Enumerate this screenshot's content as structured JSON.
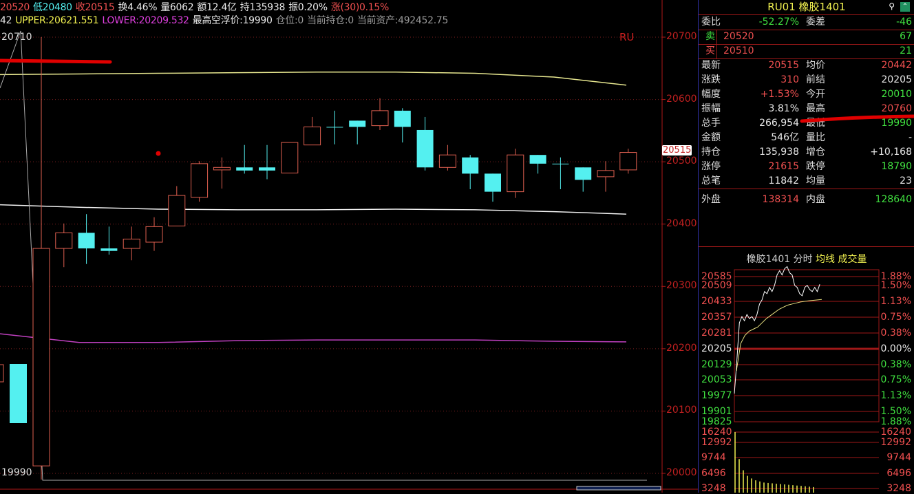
{
  "header": {
    "line1": [
      {
        "text": "20520",
        "color": "red"
      },
      {
        "text": "低20480",
        "color": "cyan"
      },
      {
        "text": "收20515",
        "color": "red"
      },
      {
        "text": "换4.46%",
        "color": "wht"
      },
      {
        "text": "量6062",
        "color": "wht"
      },
      {
        "text": "额12.4亿",
        "color": "wht"
      },
      {
        "text": "持135938",
        "color": "wht"
      },
      {
        "text": "振0.20%",
        "color": "wht"
      },
      {
        "text": "涨(30)0.15%",
        "color": "red"
      }
    ],
    "line2": [
      {
        "text": "42",
        "color": "wht"
      },
      {
        "text": "UPPER:20621.551",
        "color": "yel"
      },
      {
        "text": "LOWER:20209.532",
        "color": "mag"
      },
      {
        "text": "最高空浮价:19990",
        "color": "wht"
      },
      {
        "text": "仓位:0",
        "color": "gry"
      },
      {
        "text": "当前持仓:0",
        "color": "gry"
      },
      {
        "text": "当前资产:492452.75",
        "color": "gry"
      }
    ]
  },
  "chart": {
    "symbol_tag": "RU",
    "high_mark": "20710",
    "low_mark": "19990",
    "last_price_tag": "20515",
    "y_ticks": [
      "20700",
      "20600",
      "20500",
      "20400",
      "20300",
      "20200",
      "20100",
      "20000"
    ],
    "colors": {
      "up": "#e06050",
      "down": "#54f0f0",
      "upper": "#e8e890",
      "mid": "#f0f0f0",
      "lower": "#c040c0"
    }
  },
  "chart_data": {
    "type": "candlestick",
    "ylim": [
      19990,
      20720
    ],
    "candles": [
      {
        "o": 20012,
        "c": 20361,
        "h": 20700,
        "l": 19990
      },
      {
        "o": 20361,
        "c": 20386,
        "h": 20401,
        "l": 20331
      },
      {
        "o": 20386,
        "c": 20361,
        "h": 20416,
        "l": 20336
      },
      {
        "o": 20361,
        "c": 20357,
        "h": 20396,
        "l": 20351
      },
      {
        "o": 20361,
        "c": 20376,
        "h": 20396,
        "l": 20342
      },
      {
        "o": 20371,
        "c": 20396,
        "h": 20411,
        "l": 20357
      },
      {
        "o": 20397,
        "c": 20446,
        "h": 20461,
        "l": 20397
      },
      {
        "o": 20443,
        "c": 20497,
        "h": 20501,
        "l": 20436
      },
      {
        "o": 20487,
        "c": 20491,
        "h": 20507,
        "l": 20457
      },
      {
        "o": 20491,
        "c": 20486,
        "h": 20527,
        "l": 20481
      },
      {
        "o": 20491,
        "c": 20486,
        "h": 20527,
        "l": 20472
      },
      {
        "o": 20482,
        "c": 20531,
        "h": 20531,
        "l": 20482
      },
      {
        "o": 20527,
        "c": 20556,
        "h": 20572,
        "l": 20527
      },
      {
        "o": 20556,
        "c": 20556,
        "h": 20582,
        "l": 20528
      },
      {
        "o": 20566,
        "c": 20556,
        "h": 20566,
        "l": 20528
      },
      {
        "o": 20558,
        "c": 20582,
        "h": 20602,
        "l": 20551
      },
      {
        "o": 20582,
        "c": 20556,
        "h": 20586,
        "l": 20531
      },
      {
        "o": 20551,
        "c": 20491,
        "h": 20572,
        "l": 20486
      },
      {
        "o": 20491,
        "c": 20511,
        "h": 20527,
        "l": 20486
      },
      {
        "o": 20507,
        "c": 20481,
        "h": 20511,
        "l": 20456
      },
      {
        "o": 20481,
        "c": 20452,
        "h": 20481,
        "l": 20436
      },
      {
        "o": 20452,
        "c": 20511,
        "h": 20521,
        "l": 20442
      },
      {
        "o": 20511,
        "c": 20497,
        "h": 20511,
        "l": 20481
      },
      {
        "o": 20497,
        "c": 20497,
        "h": 20507,
        "l": 20456
      },
      {
        "o": 20491,
        "c": 20471,
        "h": 20491,
        "l": 20452
      },
      {
        "o": 20476,
        "c": 20486,
        "h": 20501,
        "l": 20452
      },
      {
        "o": 20487,
        "c": 20515,
        "h": 20521,
        "l": 20481
      }
    ],
    "bollinger": {
      "upper": [
        20640,
        20641,
        20642,
        20643,
        20644,
        20644,
        20642,
        20636,
        20623
      ],
      "mid": [
        20431,
        20427,
        20424,
        20423,
        20423,
        20424,
        20423,
        20420,
        20416
      ],
      "lower": [
        20224,
        20210,
        20210,
        20213,
        20214,
        20214,
        20214,
        20212,
        20211
      ]
    }
  },
  "quote": {
    "title": "RU01  橡胶1401",
    "rows": [
      {
        "l1": "委比",
        "v1": "-52.27%",
        "c1": "grn",
        "l2": "委差",
        "v2": "-46",
        "c2": "grn"
      },
      {
        "l1": "卖",
        "v1": "20520",
        "c1": "red",
        "l2": "",
        "v2": "67",
        "c2": "grn"
      },
      {
        "l1": "买",
        "v1": "20510",
        "c1": "red",
        "l2": "",
        "v2": "21",
        "c2": "grn"
      },
      {
        "l1": "最新",
        "v1": "20515",
        "c1": "red",
        "l2": "均价",
        "v2": "20442",
        "c2": "red"
      },
      {
        "l1": "涨跌",
        "v1": "310",
        "c1": "red",
        "l2": "前结",
        "v2": "20205",
        "c2": "wht"
      },
      {
        "l1": "幅度",
        "v1": "+1.53%",
        "c1": "red",
        "l2": "今开",
        "v2": "20010",
        "c2": "grn"
      },
      {
        "l1": "振幅",
        "v1": "3.81%",
        "c1": "wht",
        "l2": "最高",
        "v2": "20760",
        "c2": "red"
      },
      {
        "l1": "总手",
        "v1": "266,954",
        "c1": "wht",
        "l2": "最低",
        "v2": "19990",
        "c2": "grn"
      },
      {
        "l1": "金额",
        "v1": "546亿",
        "c1": "wht",
        "l2": "量比",
        "v2": "-",
        "c2": "wht"
      },
      {
        "l1": "持仓",
        "v1": "135,938",
        "c1": "wht",
        "l2": "增仓",
        "v2": "+10,168",
        "c2": "wht"
      },
      {
        "l1": "涨停",
        "v1": "21615",
        "c1": "red",
        "l2": "跌停",
        "v2": "18790",
        "c2": "grn"
      },
      {
        "l1": "总笔",
        "v1": "11842",
        "c1": "wht",
        "l2": "均量",
        "v2": "23",
        "c2": "wht"
      },
      {
        "l1": "外盘",
        "v1": "138314",
        "c1": "red",
        "l2": "内盘",
        "v2": "128640",
        "c2": "grn"
      }
    ]
  },
  "intraday": {
    "title": "橡胶1401 分时",
    "avg_label": "均线",
    "vol_label": "成交量",
    "price_labels": [
      "20585",
      "20509",
      "20433",
      "20357",
      "20281",
      "20205",
      "20129",
      "20053",
      "19977",
      "19901",
      "19825"
    ],
    "pct_labels": [
      "1.88%",
      "1.50%",
      "1.13%",
      "0.75%",
      "0.38%",
      "0.00%",
      "0.38%",
      "0.75%",
      "1.13%",
      "1.50%",
      "1.88%"
    ],
    "vol_labels": [
      "16240",
      "12992",
      "9744",
      "6496",
      "3248"
    ],
    "prices": [
      19990,
      20150,
      20330,
      20360,
      20340,
      20370,
      20350,
      20360,
      20340,
      20370,
      20420,
      20440,
      20480,
      20470,
      20500,
      20480,
      20510,
      20560,
      20580,
      20560,
      20590,
      20600,
      20570,
      20560,
      20510,
      20500,
      20470,
      20460,
      20500,
      20510,
      20490,
      20480,
      20500,
      20480,
      20515
    ],
    "avg": [
      20100,
      20230,
      20270,
      20290,
      20300,
      20310,
      20330,
      20350,
      20365,
      20380,
      20395,
      20405,
      20415,
      20420,
      20425,
      20430,
      20433,
      20436,
      20438,
      20440,
      20442
    ],
    "volumes": [
      16240,
      9000,
      6000,
      4500,
      3800,
      3300,
      3000,
      2700,
      2600,
      2500,
      2400,
      2300,
      2200,
      2100,
      2000,
      1900,
      1800,
      1700,
      1600,
      1500
    ]
  }
}
